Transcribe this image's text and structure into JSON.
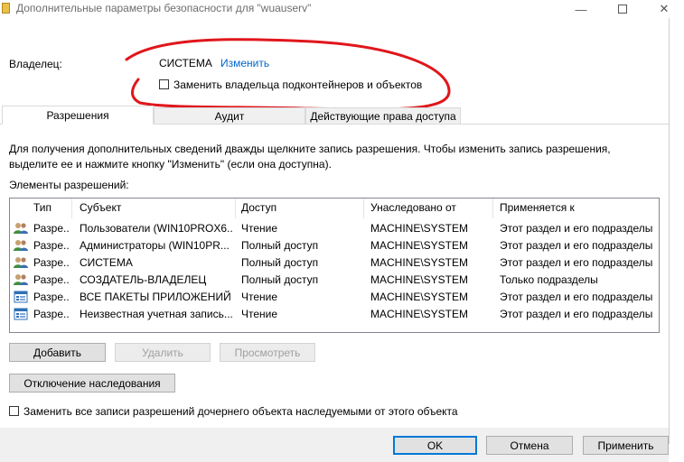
{
  "window": {
    "title": "Дополнительные параметры безопасности  для \"wuauserv\""
  },
  "owner": {
    "label": "Владелец:",
    "value": "СИСТЕМА",
    "change_link": "Изменить",
    "replace_checkbox_label": "Заменить владельца подконтейнеров и объектов"
  },
  "tabs": [
    {
      "label": "Разрешения",
      "active": true
    },
    {
      "label": "Аудит",
      "active": false
    },
    {
      "label": "Действующие права доступа",
      "active": false
    }
  ],
  "info_text": "Для получения дополнительных сведений дважды щелкните запись разрешения. Чтобы изменить запись разрешения, выделите ее и нажмите кнопку \"Изменить\" (если она доступна).",
  "entries_label": "Элементы разрешений:",
  "table": {
    "headers": [
      "Тип",
      "Субъект",
      "Доступ",
      "Унаследовано от",
      "Применяется к"
    ],
    "rows": [
      {
        "type": "Разре...",
        "subject": "Пользователи (WIN10PROX6...",
        "access": "Чтение",
        "inherited": "MACHINE\\SYSTEM",
        "applies": "Этот раздел и его подразделы",
        "icon": "users-icon"
      },
      {
        "type": "Разре...",
        "subject": "Администраторы (WIN10PR...",
        "access": "Полный доступ",
        "inherited": "MACHINE\\SYSTEM",
        "applies": "Этот раздел и его подразделы",
        "icon": "users-icon"
      },
      {
        "type": "Разре...",
        "subject": "СИСТЕМА",
        "access": "Полный доступ",
        "inherited": "MACHINE\\SYSTEM",
        "applies": "Этот раздел и его подразделы",
        "icon": "users-icon"
      },
      {
        "type": "Разре...",
        "subject": "СОЗДАТЕЛЬ-ВЛАДЕЛЕЦ",
        "access": "Полный доступ",
        "inherited": "MACHINE\\SYSTEM",
        "applies": "Только подразделы",
        "icon": "users-icon"
      },
      {
        "type": "Разре...",
        "subject": "ВСЕ ПАКЕТЫ ПРИЛОЖЕНИЙ",
        "access": "Чтение",
        "inherited": "MACHINE\\SYSTEM",
        "applies": "Этот раздел и его подразделы",
        "icon": "app-package-icon"
      },
      {
        "type": "Разре...",
        "subject": "Неизвестная учетная запись...",
        "access": "Чтение",
        "inherited": "MACHINE\\SYSTEM",
        "applies": "Этот раздел и его подразделы",
        "icon": "app-package-icon"
      }
    ]
  },
  "buttons": {
    "add": "Добавить",
    "delete": "Удалить",
    "view": "Просмотреть",
    "disable_inheritance": "Отключение наследования",
    "ok": "OK",
    "cancel": "Отмена",
    "apply": "Применить"
  },
  "replace_child_label": "Заменить все записи разрешений дочернего объекта наследуемыми от этого объекта",
  "colors": {
    "link": "#0066cc",
    "annotation": "#e0161b",
    "accent": "#0078d7"
  }
}
